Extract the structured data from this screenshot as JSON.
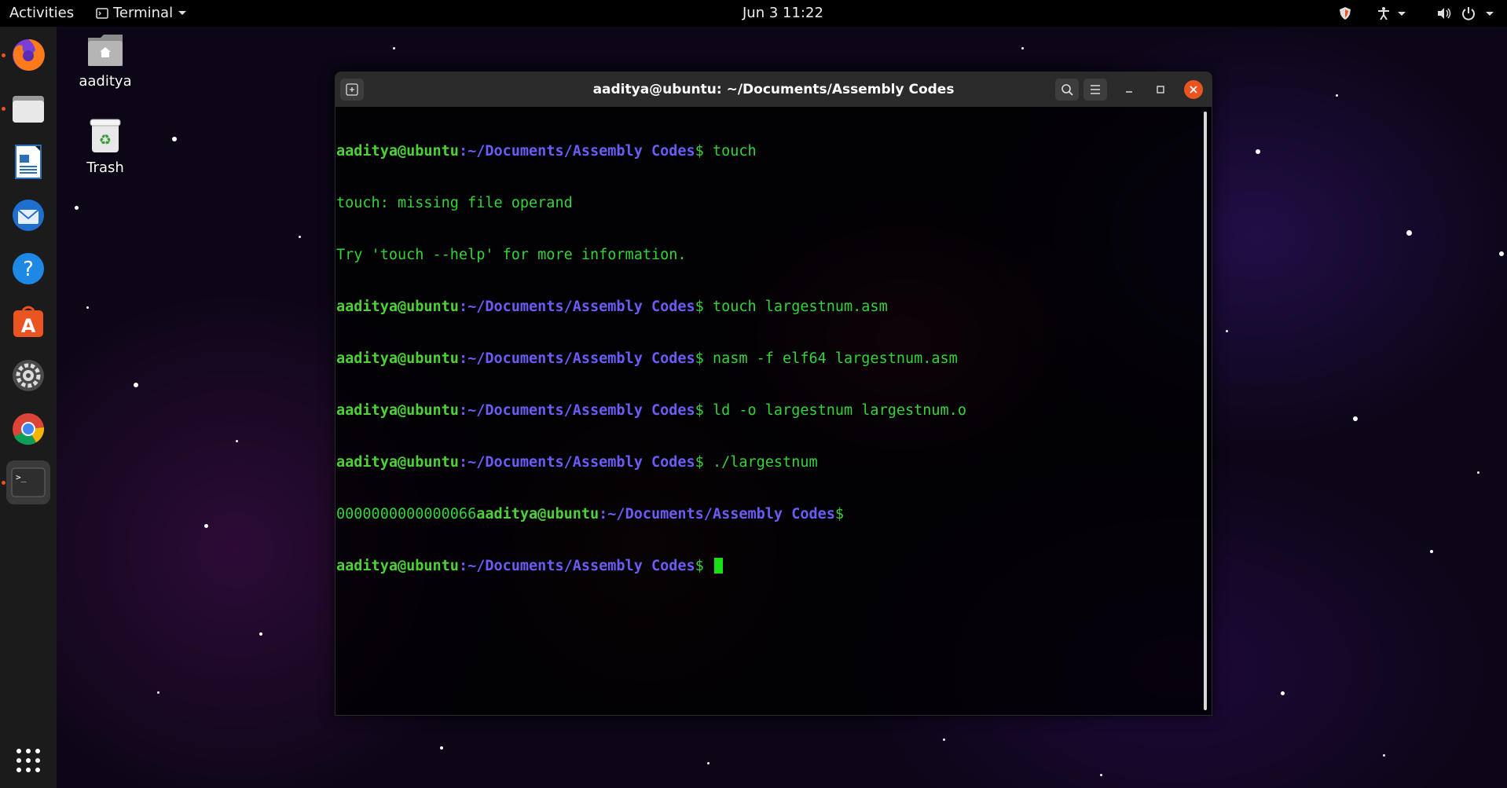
{
  "topbar": {
    "activities": "Activities",
    "app_name": "Terminal",
    "clock": "Jun 3  11:22"
  },
  "desktop_icons": [
    {
      "label": "aaditya",
      "icon": "home-folder-icon"
    },
    {
      "label": "Trash",
      "icon": "trash-icon"
    }
  ],
  "dock": {
    "items": [
      {
        "name": "firefox",
        "icon": "firefox-icon",
        "running": true
      },
      {
        "name": "files",
        "icon": "files-icon",
        "running": true
      },
      {
        "name": "writer",
        "icon": "libreoffice-writer-icon",
        "running": false
      },
      {
        "name": "thunderbird",
        "icon": "thunderbird-icon",
        "running": false
      },
      {
        "name": "help",
        "icon": "help-icon",
        "running": false
      },
      {
        "name": "software",
        "icon": "software-center-icon",
        "running": false
      },
      {
        "name": "settings",
        "icon": "settings-icon",
        "running": false
      },
      {
        "name": "chrome",
        "icon": "chrome-icon",
        "running": false
      },
      {
        "name": "terminal",
        "icon": "terminal-icon",
        "running": true
      }
    ],
    "show_apps_icon": "app-grid-icon"
  },
  "window": {
    "title": "aaditya@ubuntu: ~/Documents/Assembly Codes"
  },
  "terminal": {
    "user_host": "aaditya@ubuntu",
    "path": ":~/Documents/Assembly Codes",
    "prompt_symbol": "$",
    "lines": [
      {
        "kind": "prompt",
        "cmd": " touch"
      },
      {
        "kind": "output",
        "text": "touch: missing file operand"
      },
      {
        "kind": "output",
        "text": "Try 'touch --help' for more information."
      },
      {
        "kind": "prompt",
        "cmd": " touch largestnum.asm"
      },
      {
        "kind": "prompt",
        "cmd": " nasm -f elf64 largestnum.asm"
      },
      {
        "kind": "prompt",
        "cmd": " ld -o largestnum largestnum.o"
      },
      {
        "kind": "prompt",
        "cmd": " ./largestnum"
      },
      {
        "kind": "output_prompt",
        "text": "0000000000000066",
        "cmd": ""
      },
      {
        "kind": "prompt_cursor",
        "cmd": " "
      }
    ]
  },
  "colors": {
    "prompt_user": "#4cd137",
    "prompt_path": "#6a5cf5",
    "output": "#33d33a",
    "cursor": "#16e016"
  }
}
